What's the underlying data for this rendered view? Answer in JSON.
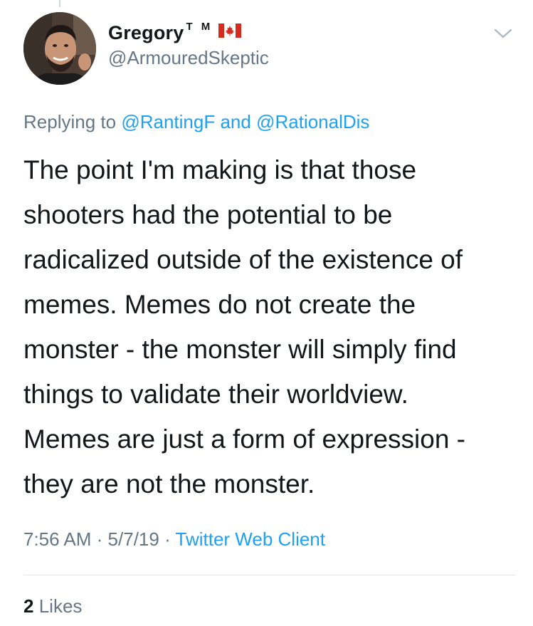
{
  "tweet": {
    "author": {
      "display_name": "Gregory",
      "tm_mark": "T M",
      "flag_icon": "canada-flag-icon",
      "handle": "@ArmouredSkeptic"
    },
    "replying": {
      "prefix": "Replying to",
      "mention_1": "@RantingF",
      "joiner": "and",
      "mention_2": "@RationalDis"
    },
    "text_lines": [
      "The point I'm making is that those",
      "shooters had the potential to be",
      "radicalized outside of the existence of",
      "memes. Memes do not create the",
      "monster - the monster will simply find",
      "things to validate their worldview.",
      "Memes are just a form of expression -",
      "they are not the monster."
    ],
    "time": "7:56 AM",
    "date": "5/7/19",
    "separator": "·",
    "source": "Twitter Web Client",
    "likes_count": "2",
    "likes_label": "Likes"
  },
  "colors": {
    "text": "#14171a",
    "secondary": "#657786",
    "link": "#1da1f2",
    "divider": "#e1e8ed",
    "flag_red": "#d52b1e"
  }
}
